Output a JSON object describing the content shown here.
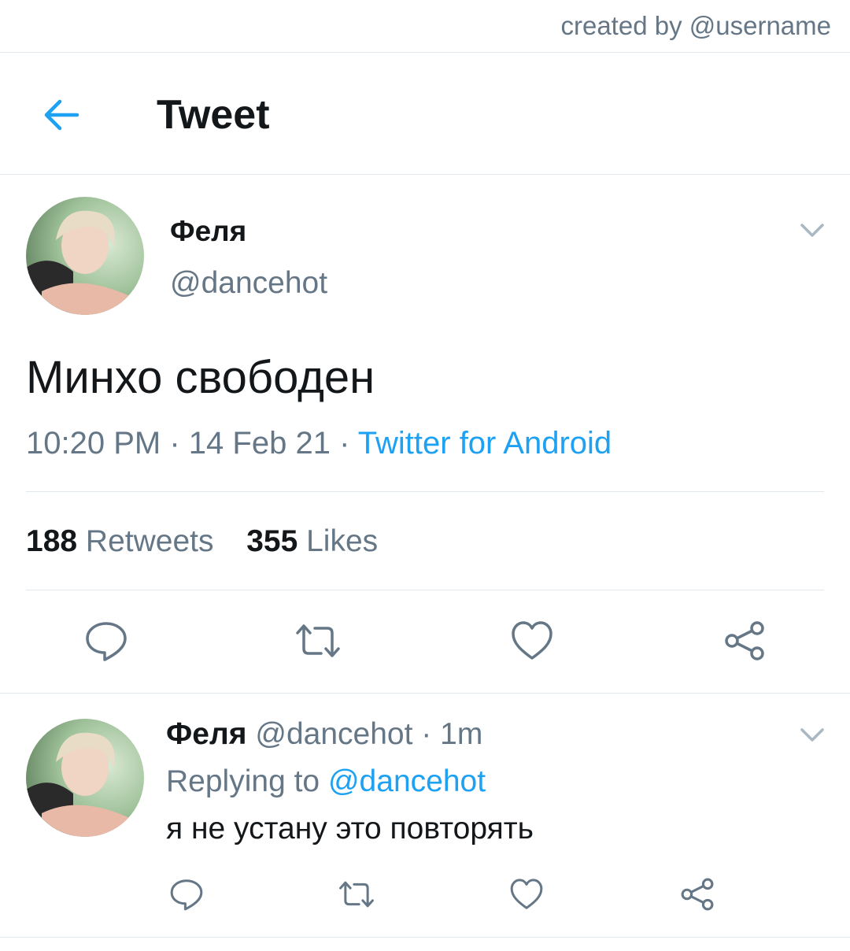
{
  "watermark": "created by @username",
  "header": {
    "title": "Tweet"
  },
  "colors": {
    "accent": "#1da1f2",
    "muted": "#657786",
    "text": "#14171a",
    "divider": "#e1e8ed"
  },
  "tweet": {
    "author_name": "Феля",
    "author_handle": "@dancehot",
    "text": "Минхо свободен",
    "time": "10:20 PM",
    "date": "14 Feb 21",
    "source": "Twitter for Android",
    "retweets_count": "188",
    "retweets_label": "Retweets",
    "likes_count": "355",
    "likes_label": "Likes",
    "sep": "·"
  },
  "reply": {
    "author_name": "Феля",
    "author_handle": "@dancehot",
    "age": "1m",
    "replying_label": "Replying to",
    "replying_handle": "@dancehot",
    "text": "я не устану это повторять",
    "sep": "·"
  },
  "icons": [
    "arrow-left-icon",
    "chevron-down-icon",
    "comment-icon",
    "retweet-icon",
    "heart-icon",
    "share-icon"
  ]
}
